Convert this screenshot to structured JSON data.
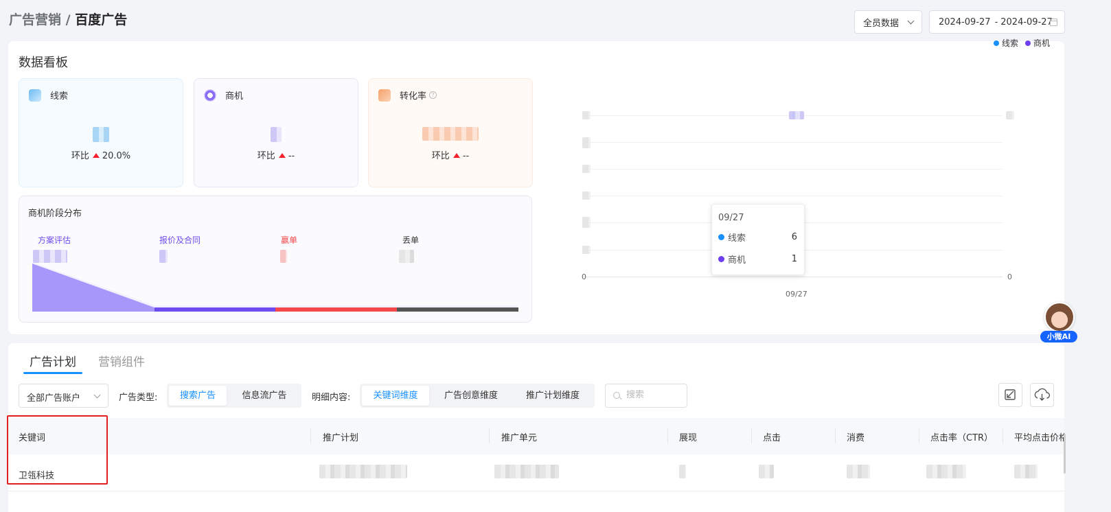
{
  "breadcrumb": {
    "parent": "广告营销",
    "separator": " / ",
    "current": "百度广告"
  },
  "header": {
    "scope": "全员数据",
    "date_start": "2024-09-27",
    "date_sep": "-",
    "date_end": "2024-09-27"
  },
  "dashboard": {
    "title": "数据看板",
    "cards": [
      {
        "label": "线索",
        "ratio_label": "环比",
        "ratio_value": "20.0%",
        "trend": "up"
      },
      {
        "label": "商机",
        "ratio_label": "环比",
        "ratio_value": "--",
        "trend": "up"
      },
      {
        "label": "转化率",
        "ratio_label": "环比",
        "ratio_value": "--",
        "trend": "up"
      }
    ],
    "stage": {
      "title": "商机阶段分布",
      "stages": [
        {
          "label": "方案评估",
          "color": "#6e4df0"
        },
        {
          "label": "报价及合同",
          "color": "#6e4df0"
        },
        {
          "label": "赢单",
          "color": "#f5484b"
        },
        {
          "label": "丢单",
          "color": "#555555"
        }
      ]
    }
  },
  "chart_data": {
    "type": "line",
    "categories": [
      "09/27"
    ],
    "series": [
      {
        "name": "线索",
        "values": [
          6
        ],
        "color": "#1890ff"
      },
      {
        "name": "商机",
        "values": [
          1
        ],
        "color": "#6e3ff0"
      }
    ],
    "axis_left_min": "0",
    "axis_right_min": "0",
    "legend": "top-right",
    "tooltip": {
      "date": "09/27",
      "rows": [
        {
          "name": "线索",
          "value": "6"
        },
        {
          "name": "商机",
          "value": "1"
        }
      ]
    }
  },
  "ai_assistant": {
    "label": "小微AI"
  },
  "tabs": [
    {
      "label": "广告计划",
      "active": true
    },
    {
      "label": "营销组件",
      "active": false
    }
  ],
  "filters": {
    "account": "全部广告账户",
    "ad_type_label": "广告类型:",
    "ad_types": [
      {
        "label": "搜索广告",
        "active": true
      },
      {
        "label": "信息流广告",
        "active": false
      }
    ],
    "detail_label": "明细内容:",
    "details": [
      {
        "label": "关键词维度",
        "active": true
      },
      {
        "label": "广告创意维度",
        "active": false
      },
      {
        "label": "推广计划维度",
        "active": false
      }
    ],
    "search_placeholder": "搜索"
  },
  "table": {
    "columns": [
      "关键词",
      "推广计划",
      "推广单元",
      "展现",
      "点击",
      "消费",
      "点击率（CTR）",
      "平均点击价格"
    ],
    "rows": [
      {
        "keyword": "卫瓴科技"
      }
    ]
  }
}
